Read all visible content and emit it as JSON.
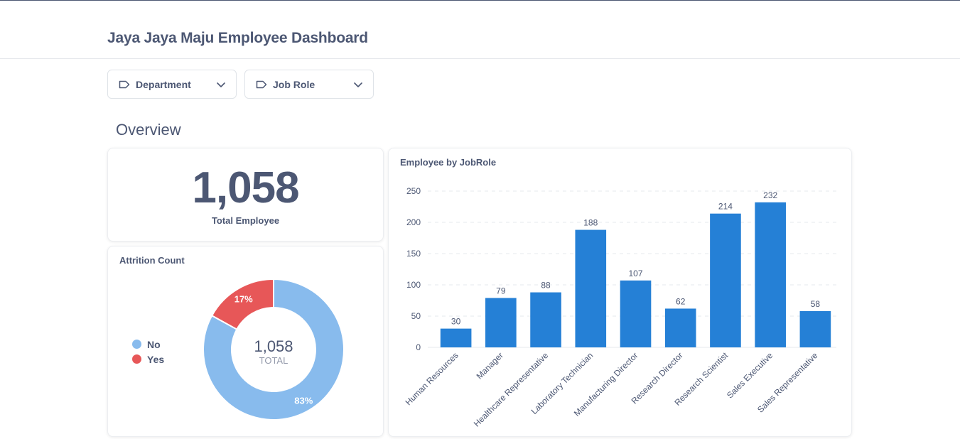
{
  "header": {
    "title": "Jaya Jaya Maju Employee Dashboard"
  },
  "filters": [
    {
      "label": "Department",
      "icon": "tag-icon"
    },
    {
      "label": "Job Role",
      "icon": "tag-icon"
    }
  ],
  "section": {
    "title": "Overview"
  },
  "kpi": {
    "value": "1,058",
    "label": "Total Employee"
  },
  "attrition": {
    "title": "Attrition Count",
    "total_value": "1,058",
    "total_label": "TOTAL",
    "legend": [
      {
        "label": "No",
        "color": "#88bbed"
      },
      {
        "label": "Yes",
        "color": "#e75758"
      }
    ]
  },
  "chart_data": [
    {
      "type": "pie",
      "title": "Attrition Count",
      "categories": [
        "No",
        "Yes"
      ],
      "values": [
        83,
        17
      ],
      "value_labels": [
        "83%",
        "17%"
      ],
      "colors": [
        "#88bbed",
        "#e75758"
      ],
      "donut": true,
      "center_value": "1,058",
      "center_label": "TOTAL",
      "legend_position": "left"
    },
    {
      "type": "bar",
      "title": "Employee by JobRole",
      "categories": [
        "Human Resources",
        "Manager",
        "Healthcare Representative",
        "Laboratory Technician",
        "Manufacturing Director",
        "Research Director",
        "Research Scientist",
        "Sales Executive",
        "Sales Representative"
      ],
      "values": [
        30,
        79,
        88,
        188,
        107,
        62,
        214,
        232,
        58
      ],
      "ylim": [
        0,
        250
      ],
      "yticks": [
        0,
        50,
        100,
        150,
        200,
        250
      ],
      "grid": true,
      "color": "#2580d6",
      "xlabel": "",
      "ylabel": ""
    }
  ]
}
